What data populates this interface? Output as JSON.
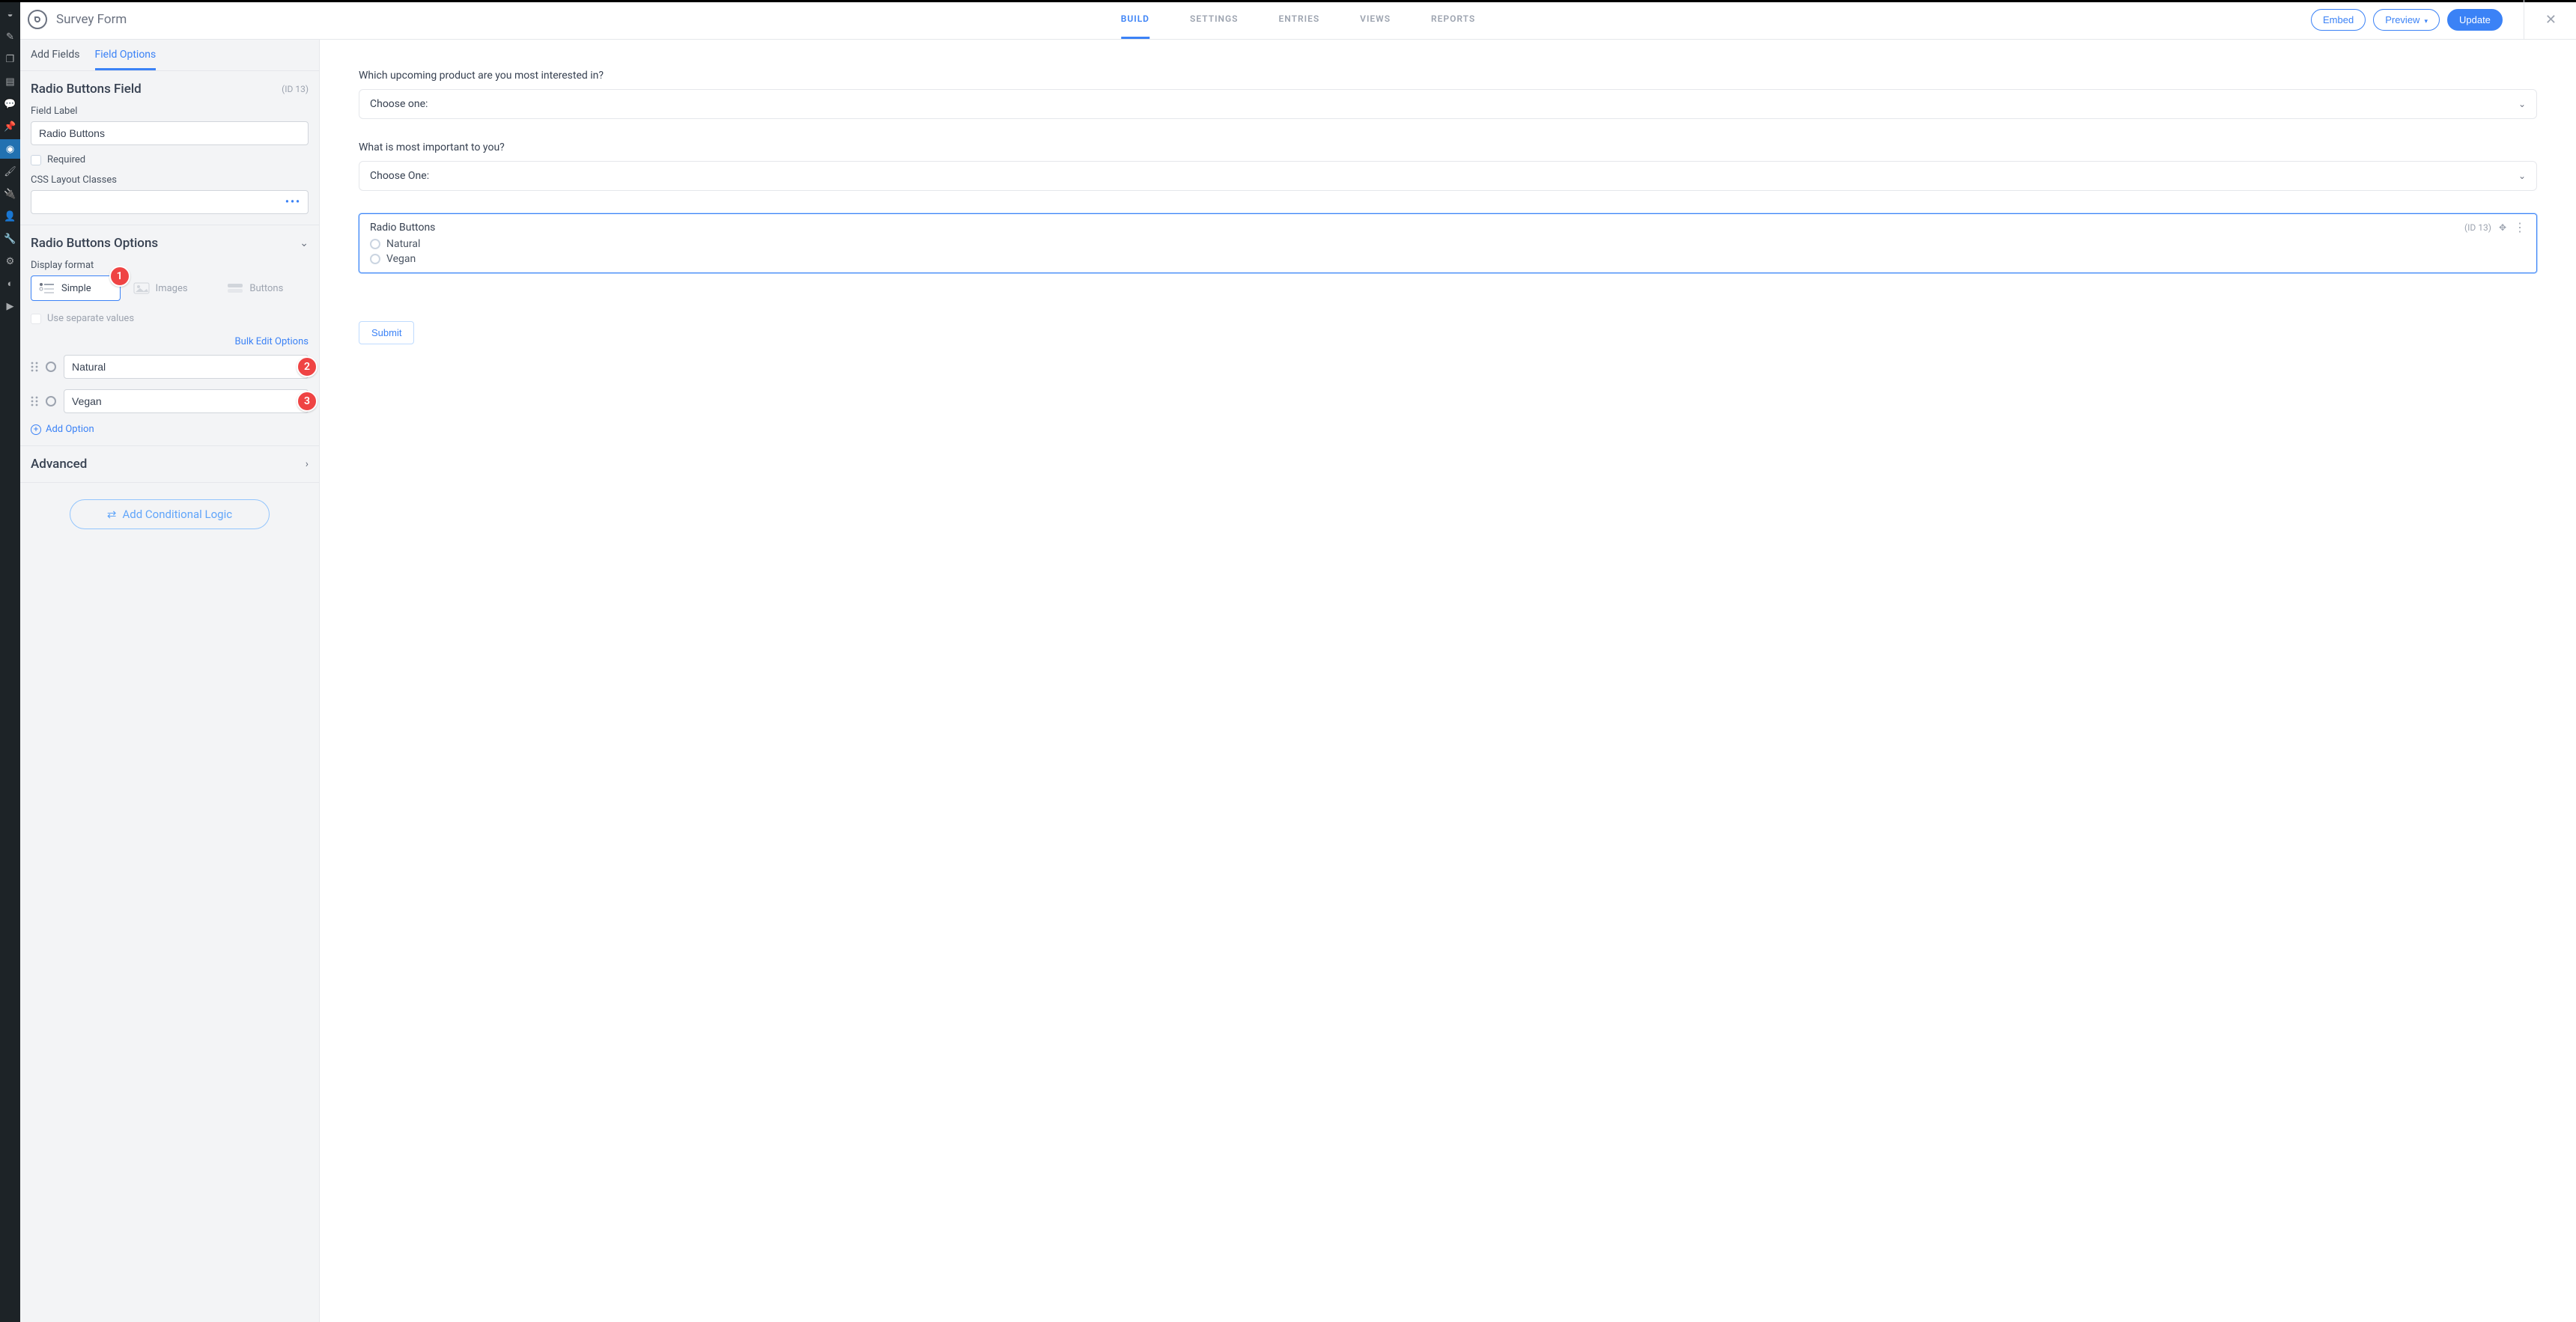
{
  "header": {
    "form_title": "Survey Form",
    "tabs": [
      "BUILD",
      "SETTINGS",
      "ENTRIES",
      "VIEWS",
      "REPORTS"
    ],
    "active_tab": 0,
    "actions": {
      "embed": "Embed",
      "preview": "Preview",
      "update": "Update"
    }
  },
  "sidebar": {
    "tabs": {
      "add_fields": "Add Fields",
      "field_options": "Field Options"
    },
    "field_head": {
      "title": "Radio Buttons Field",
      "id": "(ID 13)"
    },
    "field_label_label": "Field Label",
    "field_label_value": "Radio Buttons",
    "required_label": "Required",
    "css_classes_label": "CSS Layout Classes",
    "options_head": "Radio Buttons Options",
    "display_format_label": "Display format",
    "display_formats": {
      "simple": "Simple",
      "images": "Images",
      "buttons": "Buttons"
    },
    "use_sep_label": "Use separate values",
    "bulk_edit": "Bulk Edit Options",
    "options": [
      {
        "value": "Natural",
        "badge": "2"
      },
      {
        "value": "Vegan",
        "badge": "3"
      }
    ],
    "format_badge": "1",
    "add_option": "Add Option",
    "advanced": "Advanced",
    "add_logic": "Add Conditional Logic"
  },
  "canvas": {
    "q1": {
      "label": "Which upcoming product are you most interested in?",
      "placeholder": "Choose one:"
    },
    "q2": {
      "label": "What is most important to you?",
      "placeholder": "Choose One:"
    },
    "selected": {
      "title": "Radio Buttons",
      "id": "(ID 13)",
      "opts": [
        "Natural",
        "Vegan"
      ]
    },
    "submit": "Submit"
  }
}
